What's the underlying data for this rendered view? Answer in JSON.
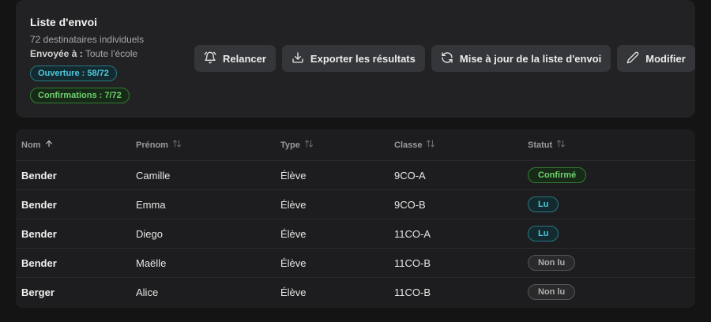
{
  "list": {
    "title": "Liste d'envoi",
    "recipients": "72 destinataires individuels",
    "sent_to_label": "Envoyée à :",
    "sent_to_value": "Toute l'école",
    "opening": "Ouverture : 58/72",
    "confirmations": "Confirmations : 7/72"
  },
  "actions": {
    "remind": "Relancer",
    "export": "Exporter les résultats",
    "update": "Mise à jour de la liste d'envoi",
    "edit": "Modifier"
  },
  "table": {
    "columns": [
      "Nom",
      "Prénom",
      "Type",
      "Classe",
      "Statut"
    ],
    "rows": [
      {
        "nom": "Bender",
        "prenom": "Camille",
        "type": "Élève",
        "classe": "9CO-A",
        "statut": "Confirmé",
        "kind": "confirmed"
      },
      {
        "nom": "Bender",
        "prenom": "Emma",
        "type": "Élève",
        "classe": "9CO-B",
        "statut": "Lu",
        "kind": "read"
      },
      {
        "nom": "Bender",
        "prenom": "Diego",
        "type": "Élève",
        "classe": "11CO-A",
        "statut": "Lu",
        "kind": "read"
      },
      {
        "nom": "Bender",
        "prenom": "Maëlle",
        "type": "Élève",
        "classe": "11CO-B",
        "statut": "Non lu",
        "kind": "unread"
      },
      {
        "nom": "Berger",
        "prenom": "Alice",
        "type": "Élève",
        "classe": "11CO-B",
        "statut": "Non lu",
        "kind": "unread"
      }
    ]
  },
  "colors": {
    "accent_cyan": "#4fc7dc",
    "accent_green": "#6fcf6f",
    "background": "#141414",
    "card": "#222224"
  }
}
